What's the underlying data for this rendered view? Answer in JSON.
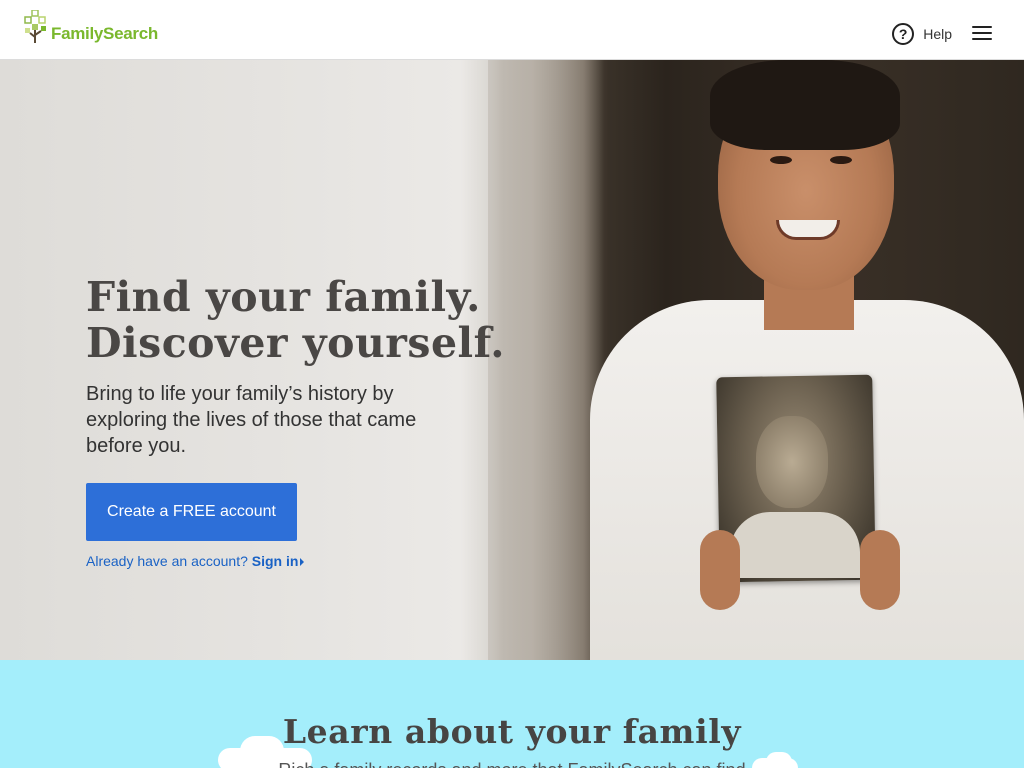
{
  "header": {
    "logo_text": "FamilySearch",
    "help_label": "Help",
    "menu_icon": "hamburger-menu-icon",
    "help_icon": "question-circle-icon"
  },
  "hero": {
    "title_line1": "Find your family.",
    "title_line2": "Discover yourself.",
    "subtitle": "Bring to life your family’s history by exploring the lives of those that came before you.",
    "cta_label": "Create a FREE account",
    "signin_prompt": "Already have an account?",
    "signin_link": "Sign in"
  },
  "learn": {
    "title": "Learn about your family",
    "subtitle": "Rich a family records and more that FamilySearch can find"
  },
  "colors": {
    "brand_green": "#7ab82d",
    "cta_blue": "#2d6fd8",
    "link_blue": "#1a62c5",
    "learn_bg": "#a4eefb"
  }
}
